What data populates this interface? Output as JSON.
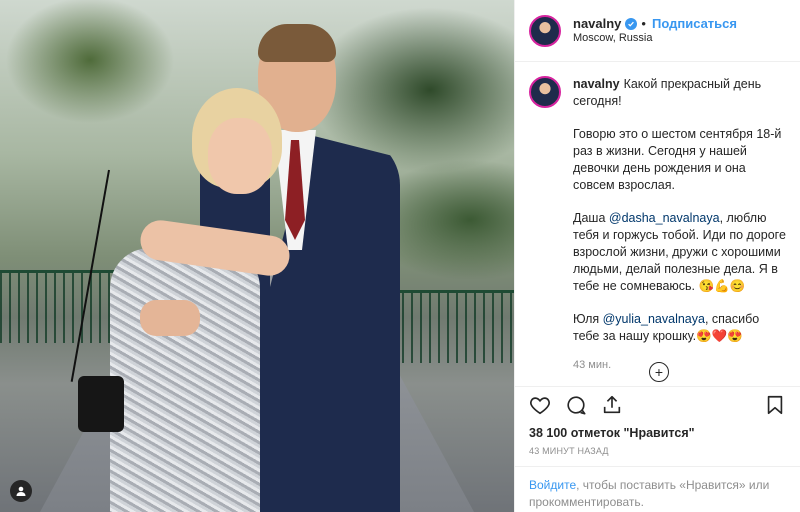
{
  "photo": {
    "alt": "",
    "avatar_icon": "person-icon"
  },
  "header": {
    "username": "navalny",
    "follow_label": "Подписаться",
    "location": "Moscow, Russia",
    "separator": "•"
  },
  "caption": {
    "username": "navalny",
    "line1": "Какой прекрасный день сегодня!",
    "p2": "Говорю это о шестом сентября 18-й раз в жизни. Сегодня у нашей девочки день рождения и она совсем взрослая.",
    "p3_before": "Даша ",
    "p3_mention": "@dasha_navalnaya",
    "p3_after": ", люблю тебя и горжусь тобой. Иди по дороге взрослой жизни, дружи с хорошими людьми, делай полезные дела. Я в тебе не сомневаюсь. 😘💪😊",
    "p4_before": "Юля ",
    "p4_mention": "@yulia_navalnaya",
    "p4_after": ", спасибо тебе за нашу крошку.😍❤️😍",
    "ago": "43 мин."
  },
  "load_more_icon": "plus-circle-icon",
  "actions": {
    "icons": [
      "heart-icon",
      "comment-icon",
      "share-icon",
      "bookmark-icon"
    ]
  },
  "likes": "38 100 отметок \"Нравится\"",
  "timestamp": "43 минут назад",
  "login": {
    "link": "Войдите",
    "rest": ", чтобы поставить «Нравится» или прокомментировать."
  },
  "colors": {
    "accent": "#3897f0",
    "text": "#262626",
    "muted": "#8e8e8e",
    "border": "#efefef"
  }
}
